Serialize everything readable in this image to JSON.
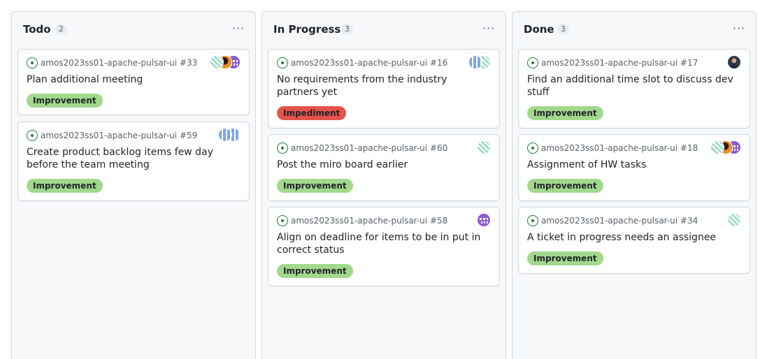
{
  "columns": [
    {
      "title": "Todo",
      "count": "2",
      "cards": [
        {
          "repo": "amos2023ss01-apache-pulsar-ui #33",
          "title": "Plan additional meeting",
          "label": "Improvement",
          "label_kind": "improvement",
          "avatars": [
            "purple",
            "orange",
            "teal"
          ]
        },
        {
          "repo": "amos2023ss01-apache-pulsar-ui #59",
          "title": "Create product backlog items few day before the team meeting",
          "label": "Improvement",
          "label_kind": "improvement",
          "avatars": [
            "blue",
            "blue"
          ]
        }
      ]
    },
    {
      "title": "In Progress",
      "count": "3",
      "cards": [
        {
          "repo": "amos2023ss01-apache-pulsar-ui #16",
          "title": "No requirements from the industry partners yet",
          "label": "Impediment",
          "label_kind": "impediment",
          "avatars": [
            "teal",
            "blue"
          ]
        },
        {
          "repo": "amos2023ss01-apache-pulsar-ui #60",
          "title": "Post the miro board earlier",
          "label": "Improvement",
          "label_kind": "improvement",
          "avatars": [
            "teal"
          ]
        },
        {
          "repo": "amos2023ss01-apache-pulsar-ui #58",
          "title": "Align on deadline for items to be in put in correct status",
          "label": "Improvement",
          "label_kind": "improvement",
          "avatars": [
            "purple"
          ]
        }
      ]
    },
    {
      "title": "Done",
      "count": "3",
      "cards": [
        {
          "repo": "amos2023ss01-apache-pulsar-ui #17",
          "title": "Find an additional time slot to discuss dev stuff",
          "label": "Improvement",
          "label_kind": "improvement",
          "avatars": [
            "person"
          ]
        },
        {
          "repo": "amos2023ss01-apache-pulsar-ui #18",
          "title": "Assignment of HW tasks",
          "label": "Improvement",
          "label_kind": "improvement",
          "avatars": [
            "purple",
            "orange",
            "teal"
          ]
        },
        {
          "repo": "amos2023ss01-apache-pulsar-ui #34",
          "title": "A ticket in progress needs an assignee",
          "label": "Improvement",
          "label_kind": "improvement",
          "avatars": [
            "teal"
          ]
        }
      ]
    }
  ],
  "column_menu_label": "···",
  "colors": {
    "open_status": "#1a7f37",
    "improvement": "#a2d88c",
    "impediment": "#e5534b"
  }
}
